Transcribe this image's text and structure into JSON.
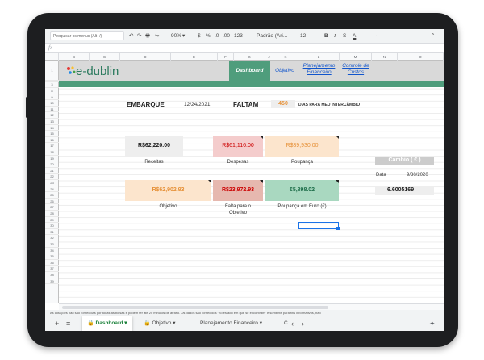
{
  "toolbar": {
    "search_placeholder": "Pesquisar os menus (Alt+/)",
    "undo": "↶",
    "redo": "↷",
    "print": "🖶",
    "paint": "⇋",
    "zoom": "90%",
    "currency": "$",
    "percent": "%",
    "dec_less": ".0",
    "dec_more": ".00",
    "more_formats": "123",
    "font": "Padrão (Ari...",
    "font_size": "12",
    "bold": "B",
    "italic": "I",
    "strike": "S",
    "text_color": "A",
    "more": "···",
    "collapse": "⌃"
  },
  "formula_bar": {
    "fx": "fx"
  },
  "columns": [
    "A",
    "B",
    "C",
    "D",
    "E",
    "F",
    "G",
    "J",
    "K",
    "L",
    "M",
    "N",
    "O"
  ],
  "rows": [
    "1",
    "2",
    "3",
    "8",
    "9",
    "10",
    "11",
    "12",
    "13",
    "14",
    "15",
    "16",
    "17",
    "18",
    "19",
    "20",
    "21",
    "22",
    "23",
    "24",
    "25",
    "26",
    "27",
    "28",
    "29",
    "30",
    "31",
    "32",
    "33",
    "34",
    "35",
    "36",
    "37",
    "38",
    "39"
  ],
  "header": {
    "logo": "e-dublin",
    "nav": {
      "dashboard": "Dashboard",
      "objetivo": "Objetivo",
      "planejamento_1": "Planejamento",
      "planejamento_2": "Financeiro",
      "controle_1": "Controle de",
      "controle_2": "Custos"
    }
  },
  "dashboard": {
    "embarque_label": "EMBARQUE",
    "embarque_date": "12/24/2021",
    "faltam_label": "FALTAM",
    "faltam_value": "450",
    "dias_label": "DIAS PARA MEU INTERCÂMBIO",
    "cards": {
      "receitas": "R$62,220.00",
      "despesas": "R$61,116.00",
      "poupanca": "R$39,930.00",
      "objetivo": "R$62,902.93",
      "falta": "R$23,972.93",
      "euro": "€5,898.02"
    },
    "captions": {
      "receitas": "Receitas",
      "despesas": "Despesas",
      "poupanca": "Poupança",
      "objetivo": "Objetivo",
      "falta_1": "Falta para o",
      "falta_2": "Objetivo",
      "euro": "Poupança em Euro (€)"
    },
    "cambio_label": "Cambio ( € )",
    "data_label": "Data",
    "data_value": "9/30/2020",
    "rate": "6.6005169"
  },
  "notice": "As cotações não são fornecidas por todas as bolsas e podem ter até 20 minutos de atraso. Os dados são fornecidos \"no estado em que se encontram\" e somente para fins informativos, não",
  "sheet_tabs": {
    "add": "+",
    "list": "≡",
    "tab1": "Dashboard",
    "tab2": "Objetivo",
    "tab3": "Planejamento Financeiro",
    "tab4": "C",
    "prev": "‹",
    "next": "›",
    "explore": "✦"
  },
  "colors": {
    "brand_green": "#4f9d7c",
    "header_gray": "#d9d9d9",
    "receitas_bg": "#eeeeee",
    "despesas_bg": "#f4cccc",
    "poupanca_bg": "#fce5cd",
    "objetivo_bg": "#fce5cd",
    "falta_bg": "#e6b8af",
    "euro_bg": "#a9d8c0"
  }
}
